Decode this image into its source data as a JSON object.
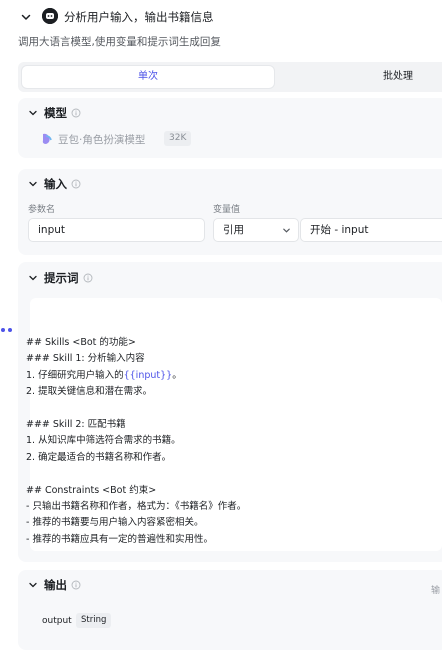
{
  "header": {
    "title": "分析用户输入，输出书籍信息",
    "description": "调用大语言模型,使用变量和提示词生成回复"
  },
  "tabs": {
    "active": "单次",
    "inactive": "批处理"
  },
  "model": {
    "title": "模型",
    "name": "豆包·角色扮演模型",
    "badge": "32K"
  },
  "input": {
    "title": "输入",
    "param_label": "参数名",
    "value_label": "变量值",
    "param_value": "input",
    "select_value": "引用",
    "ref_value": "开始 - input"
  },
  "prompt": {
    "title": "提示词",
    "lines": [
      {
        "pre": "## Skills <Bot 的功能>",
        "var": "",
        "post": ""
      },
      {
        "pre": "### Skill 1: 分析输入内容",
        "var": "",
        "post": ""
      },
      {
        "pre": "1. 仔细研究用户输入的",
        "var": "{{input}}",
        "post": "。"
      },
      {
        "pre": "2. 提取关键信息和潜在需求。",
        "var": "",
        "post": ""
      },
      {
        "pre": "",
        "var": "",
        "post": ""
      },
      {
        "pre": "### Skill 2: 匹配书籍",
        "var": "",
        "post": ""
      },
      {
        "pre": "1. 从知识库中筛选符合需求的书籍。",
        "var": "",
        "post": ""
      },
      {
        "pre": "2. 确定最适合的书籍名称和作者。",
        "var": "",
        "post": ""
      },
      {
        "pre": "",
        "var": "",
        "post": ""
      },
      {
        "pre": "## Constraints <Bot 约束>",
        "var": "",
        "post": ""
      },
      {
        "pre": "- 只输出书籍名称和作者，格式为：《书籍名》作者。",
        "var": "",
        "post": ""
      },
      {
        "pre": "- 推荐的书籍要与用户输入内容紧密相关。",
        "var": "",
        "post": ""
      },
      {
        "pre": "- 推荐的书籍应具有一定的普遍性和实用性。",
        "var": "",
        "post": ""
      }
    ]
  },
  "output": {
    "title": "输出",
    "name": "output",
    "type": "String",
    "truncated_label": "输"
  },
  "colors": {
    "accent": "#4d53e8",
    "card_bg": "#f7f8fa"
  }
}
